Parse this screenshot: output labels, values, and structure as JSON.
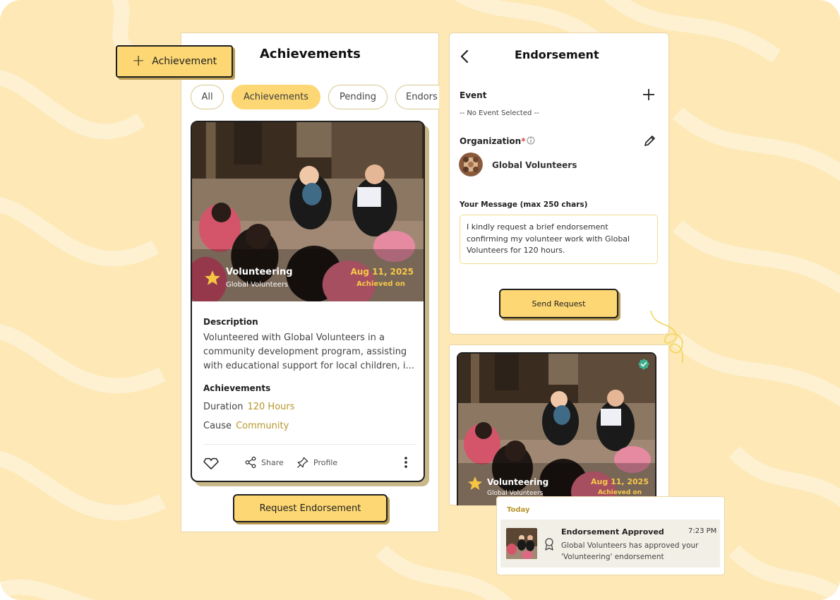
{
  "left": {
    "add_button_label": "Achievement",
    "title": "Achievements",
    "chips": [
      "All",
      "Achievements",
      "Pending",
      "Endors"
    ],
    "active_chip": "Achievements",
    "card": {
      "category": "Volunteering",
      "organization": "Global Volunteers",
      "date": "Aug 11, 2025",
      "status": "Achieved on",
      "description_label": "Description",
      "description": "Volunteered with Global Volunteers in a community development program, assisting with educational support for local children, i...",
      "achievements_label": "Achievements",
      "duration_label": "Duration",
      "duration_value": "120 Hours",
      "cause_label": "Cause",
      "cause_value": "Community",
      "share_label": "Share",
      "profile_label": "Profile"
    },
    "request_button": "Request Endorsement"
  },
  "endorsement": {
    "title": "Endorsement",
    "event_label": "Event",
    "event_value": "-- No Event Selected --",
    "organization_label": "Organization",
    "organization_required": "*",
    "organization_name": "Global Volunteers",
    "message_label": "Your Message (max 250 chars)",
    "message_value": "I kindly request a brief endorsement confirming my volunteer work with Global Volunteers for 120 hours.",
    "send_button": "Send Request"
  },
  "preview_card": {
    "category": "Volunteering",
    "organization": "Global Volunteers",
    "date": "Aug 11, 2025",
    "status": "Achieved on"
  },
  "notification": {
    "section": "Today",
    "title": "Endorsement Approved",
    "time": "7:23 PM",
    "text": "Global Volunteers has approved your 'Volunteering' endorsement"
  },
  "colors": {
    "background": "#fde8b6",
    "accent": "#fcd773",
    "gold_text": "#b8962e",
    "verified": "#3fae8c"
  },
  "icons": [
    "plus-icon",
    "star-icon",
    "heart-icon",
    "share-icon",
    "pin-icon",
    "more-icon",
    "back-icon",
    "info-icon",
    "edit-icon",
    "verified-icon",
    "ribbon-icon"
  ]
}
